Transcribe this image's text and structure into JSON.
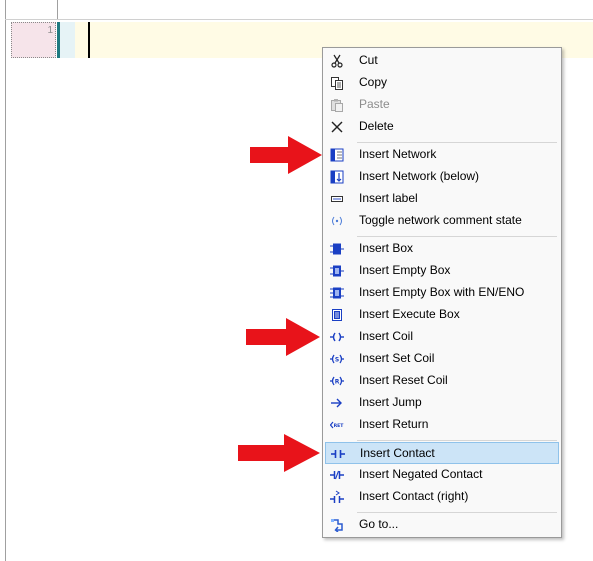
{
  "editor": {
    "network_number": "1"
  },
  "context_menu": {
    "items": [
      {
        "label": "Cut",
        "icon": "scissors-icon",
        "enabled": true
      },
      {
        "label": "Copy",
        "icon": "copy-icon",
        "enabled": true
      },
      {
        "label": "Paste",
        "icon": "paste-icon",
        "enabled": false
      },
      {
        "label": "Delete",
        "icon": "delete-x-icon",
        "enabled": true
      },
      {
        "label": "Insert Network",
        "icon": "insert-network-icon",
        "enabled": true
      },
      {
        "label": "Insert Network (below)",
        "icon": "insert-network-below-icon",
        "enabled": true
      },
      {
        "label": "Insert label",
        "icon": "insert-label-icon",
        "enabled": true
      },
      {
        "label": "Toggle network comment state",
        "icon": "toggle-comment-icon",
        "enabled": true
      },
      {
        "label": "Insert Box",
        "icon": "insert-box-icon",
        "enabled": true
      },
      {
        "label": "Insert Empty Box",
        "icon": "insert-empty-box-icon",
        "enabled": true
      },
      {
        "label": "Insert Empty Box with EN/ENO",
        "icon": "insert-empty-box-en-eno-icon",
        "enabled": true
      },
      {
        "label": "Insert Execute Box",
        "icon": "insert-execute-box-icon",
        "enabled": true
      },
      {
        "label": "Insert Coil",
        "icon": "insert-coil-icon",
        "enabled": true
      },
      {
        "label": "Insert Set Coil",
        "icon": "insert-set-coil-icon",
        "enabled": true
      },
      {
        "label": "Insert Reset Coil",
        "icon": "insert-reset-coil-icon",
        "enabled": true
      },
      {
        "label": "Insert Jump",
        "icon": "insert-jump-icon",
        "enabled": true
      },
      {
        "label": "Insert Return",
        "icon": "insert-return-icon",
        "enabled": true
      },
      {
        "label": "Insert Contact",
        "icon": "insert-contact-icon",
        "enabled": true,
        "highlighted": true
      },
      {
        "label": "Insert Negated Contact",
        "icon": "insert-negated-contact-icon",
        "enabled": true
      },
      {
        "label": "Insert Contact (right)",
        "icon": "insert-contact-right-icon",
        "enabled": true
      },
      {
        "label": "Go to...",
        "icon": "goto-icon",
        "enabled": true
      }
    ]
  },
  "colors": {
    "arrow_red": "#e8131a",
    "highlight_bg": "#cce4f7",
    "ladder_blue": "#1a3fc4",
    "network_body": "#fffbe5"
  }
}
